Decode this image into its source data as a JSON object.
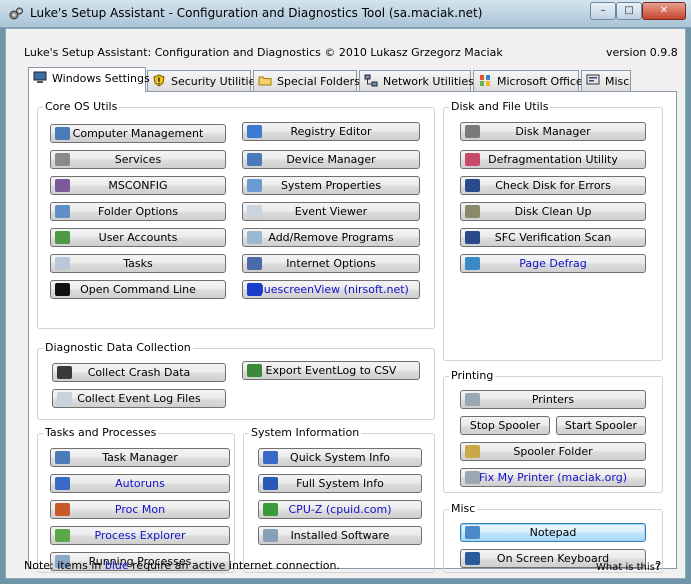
{
  "window": {
    "title": "Luke's Setup Assistant - Configuration and Diagnostics Tool (sa.maciak.net)",
    "minimize": "–",
    "maximize": "□",
    "close": "✕"
  },
  "header": {
    "heading": "Luke's Setup Assistant: Configuration and Diagnostics © 2010 Lukasz Grzegorz Maciak",
    "version": "version 0.9.8"
  },
  "tabs": [
    {
      "label": "Windows Settings",
      "icon": "computer-icon",
      "active": true
    },
    {
      "label": "Security Utilities",
      "icon": "shield-warning-icon"
    },
    {
      "label": "Special Folders",
      "icon": "folder-icon"
    },
    {
      "label": "Network Utilities",
      "icon": "network-icon"
    },
    {
      "label": "Microsoft Office",
      "icon": "office-icon"
    },
    {
      "label": "Misc",
      "icon": "misc-icon"
    }
  ],
  "groups": {
    "core_os": {
      "title": "Core OS Utils",
      "left": [
        "Computer Management",
        "Services",
        "MSCONFIG",
        "Folder Options",
        "User Accounts",
        "Tasks",
        "Open Command Line"
      ],
      "right": [
        "Registry Editor",
        "Device Manager",
        "System Properties",
        "Event Viewer",
        "Add/Remove Programs",
        "Internet Options",
        "BluescreenView (nirsoft.net)"
      ]
    },
    "diagnostic": {
      "title": "Diagnostic Data Collection",
      "items": [
        "Collect Crash Data",
        "Export EventLog to CSV",
        "Collect Event Log Files"
      ]
    },
    "tasks": {
      "title": "Tasks and Processes",
      "items": [
        "Task Manager",
        "Autoruns",
        "Proc Mon",
        "Process Explorer",
        "Running Processes"
      ]
    },
    "sysinfo": {
      "title": "System Information",
      "items": [
        "Quick System Info",
        "Full System Info",
        "CPU-Z (cpuid.com)",
        "Installed Software"
      ]
    },
    "disk": {
      "title": "Disk and File Utils",
      "items": [
        "Disk Manager",
        "Defragmentation Utility",
        "Check Disk for Errors",
        "Disk Clean Up",
        "SFC Verification Scan",
        "Page Defrag"
      ]
    },
    "printing": {
      "title": "Printing",
      "items": [
        "Printers",
        "Stop Spooler",
        "Start Spooler",
        "Spooler Folder",
        "Fix My Printer (maciak.org)"
      ]
    },
    "misc": {
      "title": "Misc",
      "items": [
        "Notepad",
        "On Screen Keyboard"
      ]
    }
  },
  "footer": {
    "note_prefix": "Note: items in",
    "note_blue": "blue",
    "note_suffix": "require an active internet connection.",
    "what_is_this": "What is this?",
    "help_glyph": "?"
  },
  "colors": {
    "online_item": "#1010c8",
    "title_bar": "#a8c4d6"
  }
}
